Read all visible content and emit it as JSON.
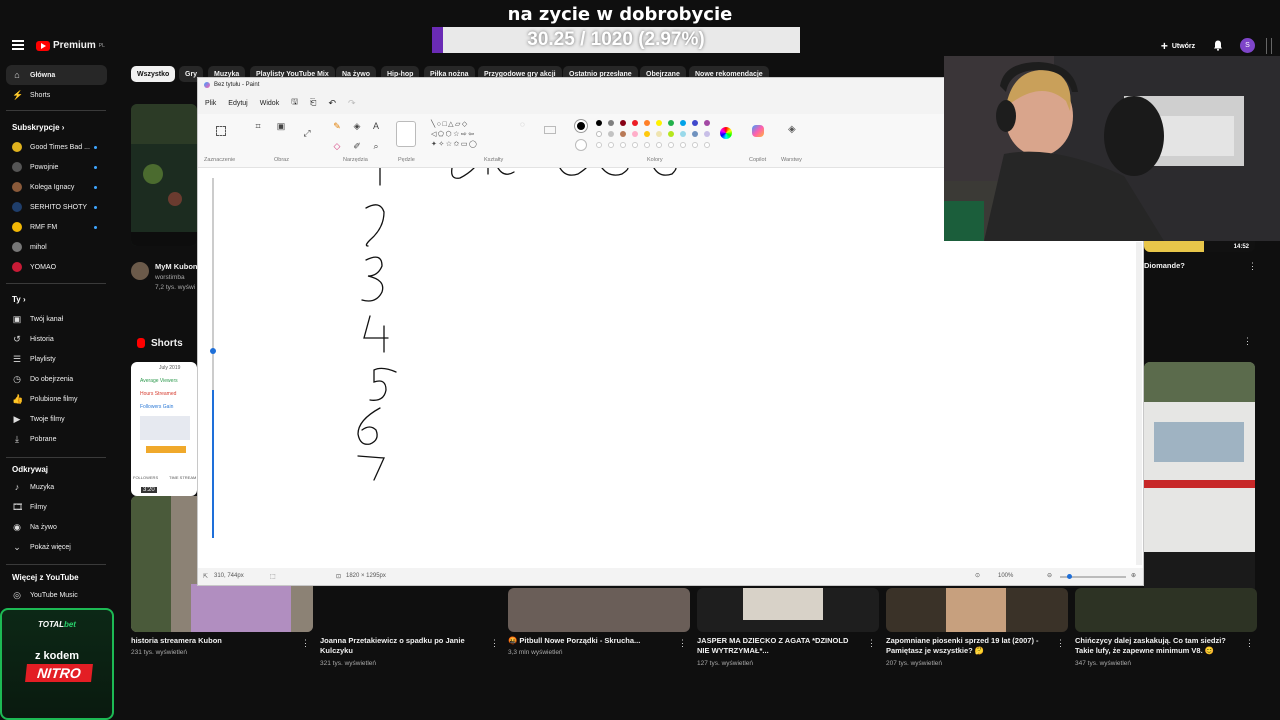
{
  "overlay": {
    "title": "na zycie w dobrobycie",
    "goal_text": "30.25 / 1020 (2.97%)",
    "goal_progress_percent": 2.97,
    "colors": {
      "fill": "#6a2bb5",
      "track": "#e9e9e9"
    }
  },
  "youtube": {
    "logo_text": "Premium",
    "logo_suffix": "PL",
    "create_label": "Utwórz",
    "avatar_letter": "S",
    "sidebar": {
      "main": [
        {
          "label": "Główna",
          "icon": "home-icon",
          "active": true
        },
        {
          "label": "Shorts",
          "icon": "shorts-icon"
        }
      ],
      "subs_heading": "Subskrypcje",
      "subs": [
        {
          "label": "Good Times Bad ...",
          "color": "#e0b21e"
        },
        {
          "label": "Powojnie",
          "color": "#555555"
        },
        {
          "label": "Kolega Ignacy",
          "color": "#8a5a3a"
        },
        {
          "label": "SERHITO SHOTY",
          "color": "#1f3e6b"
        },
        {
          "label": "RMF FM",
          "color": "#f2b705"
        },
        {
          "label": "mihol",
          "color": "#777777"
        },
        {
          "label": "YOMAO",
          "color": "#c81b36"
        }
      ],
      "you_heading": "Ty",
      "you": [
        {
          "label": "Twój kanał",
          "icon": "channel-icon"
        },
        {
          "label": "Historia",
          "icon": "history-icon"
        },
        {
          "label": "Playlisty",
          "icon": "playlist-icon"
        },
        {
          "label": "Do obejrzenia",
          "icon": "clock-icon"
        },
        {
          "label": "Polubione filmy",
          "icon": "thumb-up-icon"
        },
        {
          "label": "Twoje filmy",
          "icon": "video-icon"
        },
        {
          "label": "Pobrane",
          "icon": "download-icon"
        }
      ],
      "explore_heading": "Odkrywaj",
      "explore": [
        {
          "label": "Muzyka",
          "icon": "music-icon"
        },
        {
          "label": "Filmy",
          "icon": "film-icon"
        },
        {
          "label": "Na żywo",
          "icon": "live-icon"
        },
        {
          "label": "Pokaż więcej",
          "icon": "chevron-down-icon"
        }
      ],
      "more_heading": "Więcej z YouTube",
      "more": [
        {
          "label": "YouTube Music",
          "icon": "yt-music-icon"
        }
      ]
    },
    "chips": [
      "Wszystko",
      "Gry",
      "Muzyka",
      "Playlisty YouTube Mix",
      "Na żywo",
      "Hip-hop",
      "Piłka nożna",
      "Przygodowe gry akcji",
      "Ostatnio przesłane",
      "Obejrzane",
      "Nowe rekomendacje"
    ],
    "top_video": {
      "title": "MyM Kubon",
      "channel": "worstimba",
      "meta": "7,2 tys. wyświ"
    },
    "right_video": {
      "title": "Diomande?",
      "duration": "14:52"
    },
    "shorts_heading": "Shorts",
    "short_duration": "3:20",
    "stats_card": {
      "date": "July 2019",
      "rows": [
        "Average Viewers",
        "Hours Streamed",
        "Followers Gain"
      ],
      "legend": [
        "FOLLOWERS",
        "TIME STREAM"
      ]
    },
    "bottom_videos": [
      {
        "title": "historia streamera Kubon",
        "meta": "231 tys. wyświetleń"
      },
      {
        "title": "Joanna Przetakiewicz o spadku po Janie Kulczyku",
        "meta": "321 tys. wyświetleń"
      },
      {
        "title": "🤬 Pitbull Nowe Porządki - Skrucha...",
        "meta": "3,3 mln wyświetleń"
      },
      {
        "title": "JASPER MA DZIECKO Z AGATA *DZINOLD NIE WYTRZYMAŁ*...",
        "meta": "127 tys. wyświetleń"
      },
      {
        "title": "Zapomniane piosenki sprzed 19 lat (2007) - Pamiętasz je wszystkie? 🤔",
        "meta": "207 tys. wyświetleń"
      },
      {
        "title": "Chińczycy dalej zaskakują. Co tam siedzi? Takie lufy, że zapewne minimum V8. 😊",
        "meta": "347 tys. wyświetleń"
      }
    ]
  },
  "paint": {
    "window_title": "Bez tytułu - Paint",
    "menu": [
      "Plik",
      "Edytuj",
      "Widok"
    ],
    "groups": [
      "Zaznaczenie",
      "Obraz",
      "Narzędzia",
      "Pędzle",
      "Kształty",
      "Kolory",
      "Copilot",
      "Warstwy"
    ],
    "colors": [
      "#000000",
      "#7f7f7f",
      "#880015",
      "#ed1c24",
      "#ff7f27",
      "#fff200",
      "#22b14c",
      "#00a2e8",
      "#3f48cc",
      "#a349a4",
      "#ffffff",
      "#c3c3c3",
      "#b97a57",
      "#ffaec9",
      "#ffc90e",
      "#efe4b0",
      "#b5e61d",
      "#99d9ea",
      "#7092be",
      "#c8bfe7"
    ],
    "cursor_pos": "310, 744px",
    "canvas_size": "1820 × 1295px",
    "zoom": "100%",
    "drawn_digits": [
      "1",
      "2",
      "3",
      "4",
      "5",
      "6",
      "7"
    ]
  },
  "sponsor": {
    "brand_a": "TOTAL",
    "brand_b": "bet",
    "line1": "z kodem",
    "code": "NITRO"
  }
}
